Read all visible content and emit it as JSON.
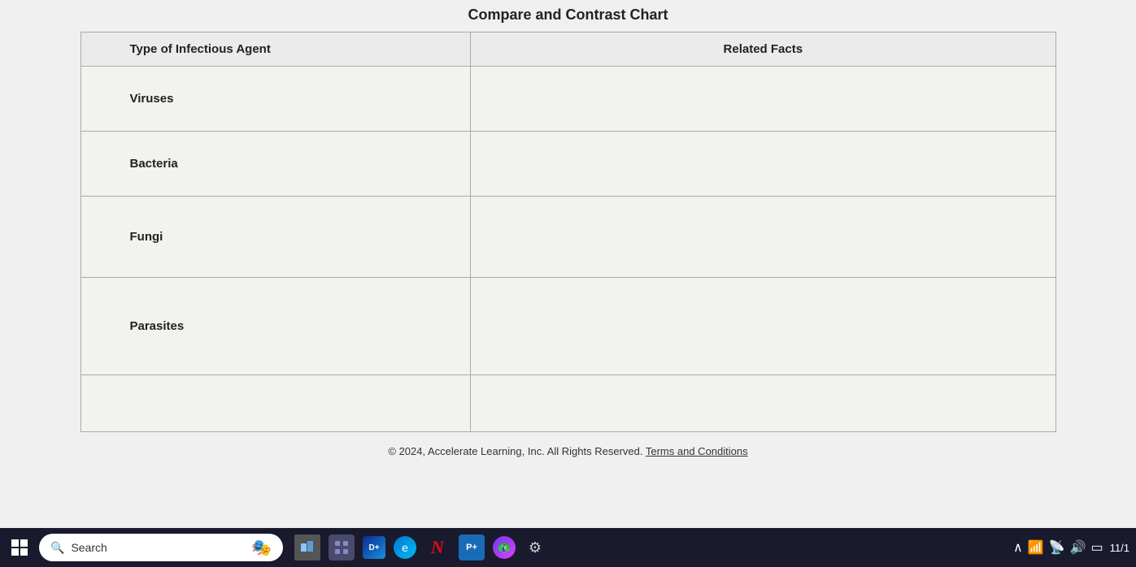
{
  "chart": {
    "title": "Compare and Contrast Chart",
    "columns": {
      "left": "Type of Infectious Agent",
      "right": "Related Facts"
    },
    "rows": [
      {
        "agent": "Viruses",
        "facts": ""
      },
      {
        "agent": "Bacteria",
        "facts": ""
      },
      {
        "agent": "Fungi",
        "facts": ""
      },
      {
        "agent": "Parasites",
        "facts": ""
      },
      {
        "agent": "",
        "facts": ""
      }
    ]
  },
  "footer": {
    "copyright": "© 2024,  Accelerate Learning, Inc.  All Rights Reserved.",
    "link_text": "Terms and Conditions"
  },
  "taskbar": {
    "search_placeholder": "Search",
    "time": "11/1"
  }
}
